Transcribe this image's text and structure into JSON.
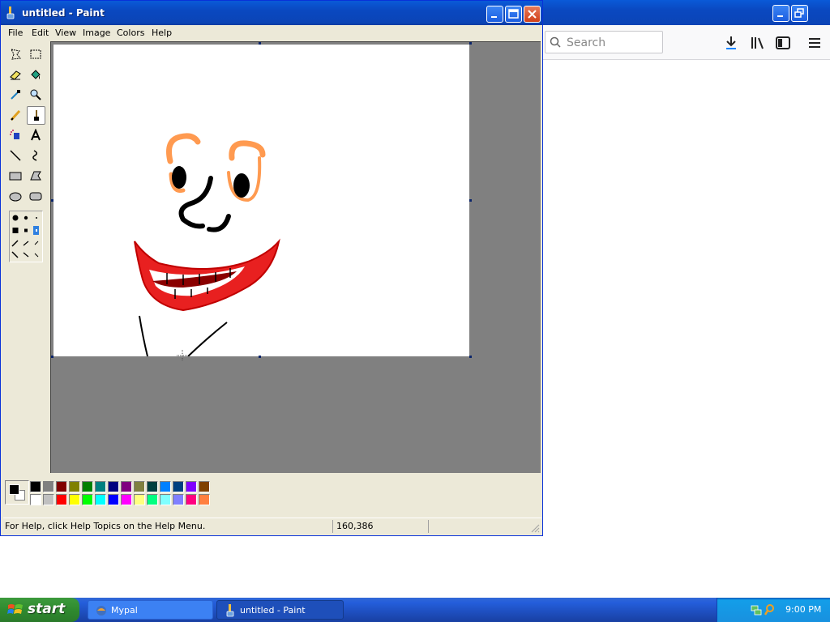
{
  "browser": {
    "search_placeholder": "Search",
    "window_controls": {
      "minimize": "minimize-icon",
      "restore": "restore-icon"
    },
    "toolbar_icons": [
      "download-icon",
      "library-icon",
      "sidebar-icon",
      "menu-icon"
    ]
  },
  "paint": {
    "title": "untitled - Paint",
    "menu": [
      "File",
      "Edit",
      "View",
      "Image",
      "Colors",
      "Help"
    ],
    "tools": [
      "free-form-select-icon",
      "select-icon",
      "eraser-icon",
      "fill-icon",
      "pick-color-icon",
      "magnifier-icon",
      "pencil-icon",
      "brush-icon",
      "airbrush-icon",
      "text-icon",
      "line-icon",
      "curve-icon",
      "rectangle-icon",
      "polygon-icon",
      "ellipse-icon",
      "rounded-rectangle-icon"
    ],
    "selected_tool": "brush-icon",
    "palette_top": [
      "#000000",
      "#808080",
      "#800000",
      "#808000",
      "#008000",
      "#008080",
      "#000080",
      "#800080",
      "#808040",
      "#004040",
      "#0080ff",
      "#004080",
      "#8000ff",
      "#804000"
    ],
    "palette_bottom": [
      "#ffffff",
      "#c0c0c0",
      "#ff0000",
      "#ffff00",
      "#00ff00",
      "#00ffff",
      "#0000ff",
      "#ff00ff",
      "#ffff80",
      "#00ff80",
      "#80ffff",
      "#8080ff",
      "#ff0080",
      "#ff8040"
    ],
    "foreground_color": "#000000",
    "background_color": "#ffffff",
    "status": {
      "help_text": "For Help, click Help Topics on the Help Menu.",
      "coordinates": "160,386"
    }
  },
  "taskbar": {
    "start_label": "start",
    "tasks": [
      {
        "label": "Mypal",
        "active": false
      },
      {
        "label": "untitled - Paint",
        "active": true
      }
    ],
    "clock": "9:00 PM"
  }
}
